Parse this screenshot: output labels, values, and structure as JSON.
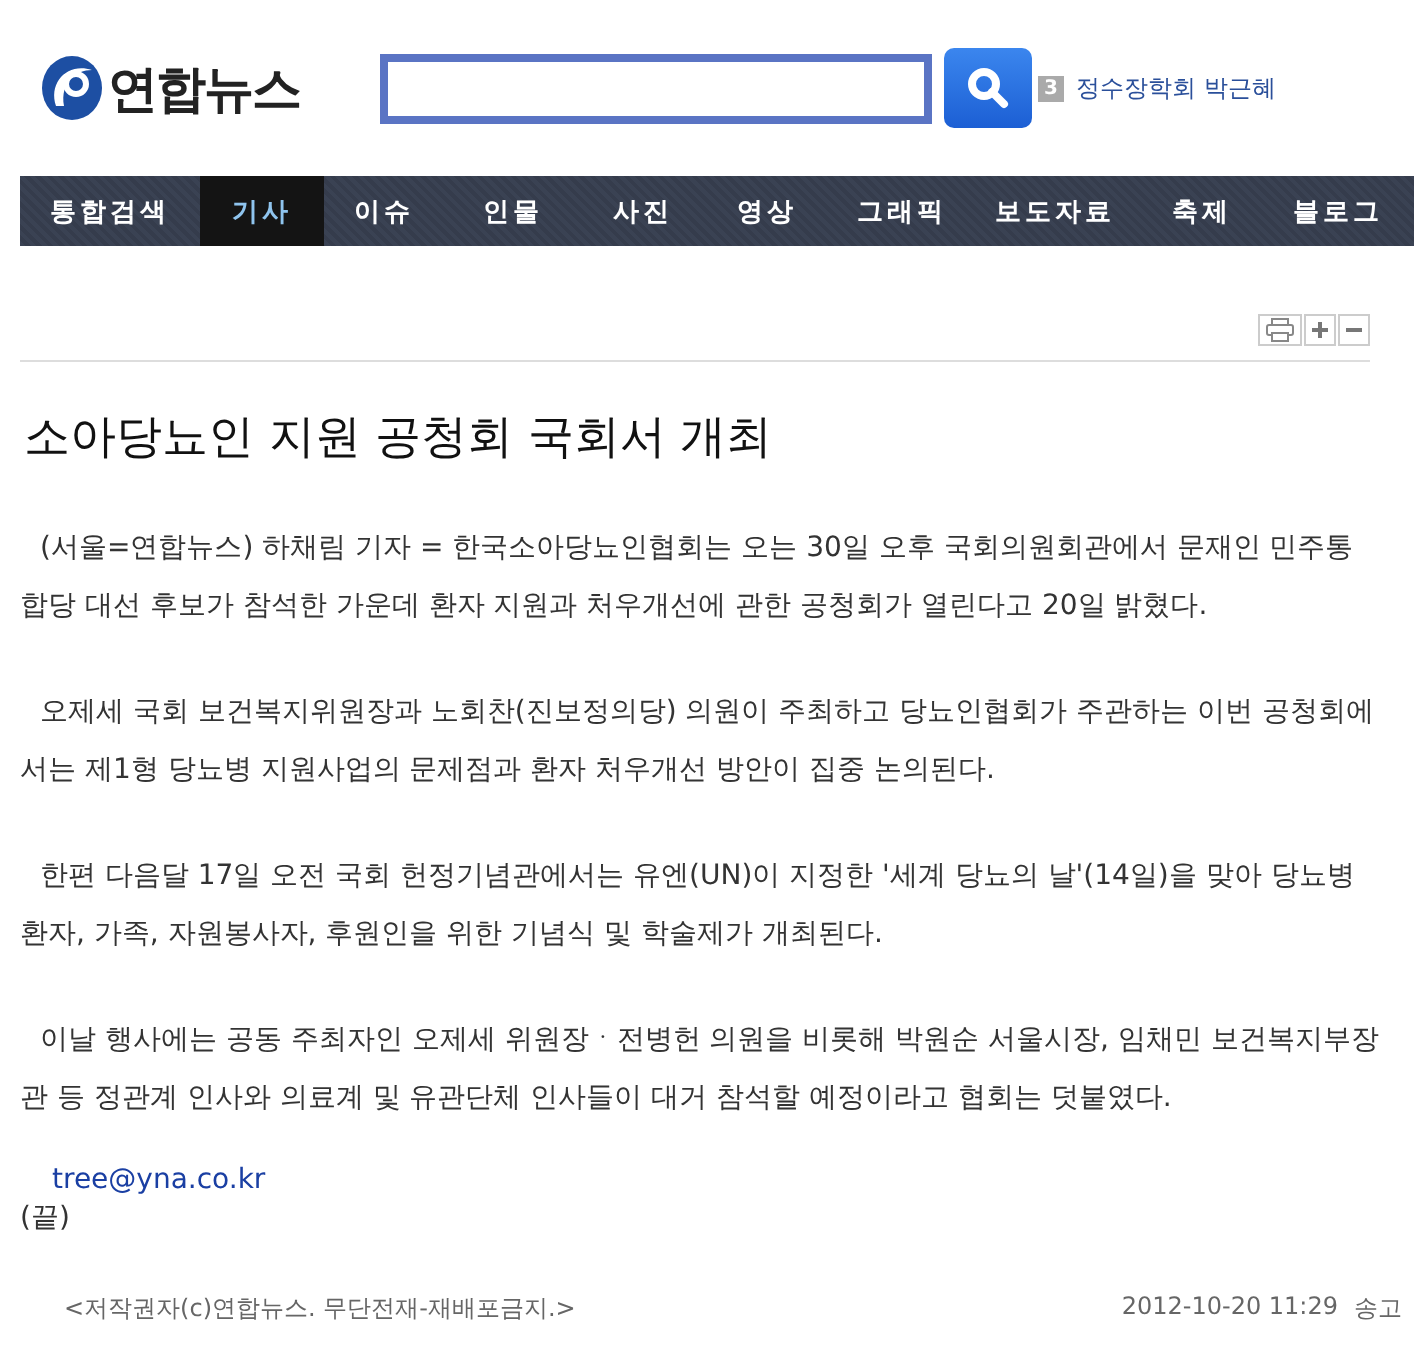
{
  "header": {
    "logo": "연합뉴스",
    "trending": {
      "rank": "3",
      "text": "정수장학회 박근혜"
    }
  },
  "nav": [
    {
      "label": "통합검색",
      "selected": false
    },
    {
      "label": "기사",
      "selected": true
    },
    {
      "label": "이슈",
      "selected": false
    },
    {
      "label": "인물",
      "selected": false
    },
    {
      "label": "사진",
      "selected": false
    },
    {
      "label": "영상",
      "selected": false
    },
    {
      "label": "그래픽",
      "selected": false
    },
    {
      "label": "보도자료",
      "selected": false
    },
    {
      "label": "축제",
      "selected": false
    },
    {
      "label": "블로그",
      "selected": false
    }
  ],
  "tools": [
    {
      "kind": "print"
    },
    {
      "kind": "plus"
    },
    {
      "kind": "minus"
    }
  ],
  "article": {
    "title": "소아당뇨인 지원 공청회 국회서 개최",
    "paragraphs": [
      "(서울=연합뉴스) 하채림 기자 = 한국소아당뇨인협회는 오는 30일 오후 국회의원회관에서 문재인 민주통합당 대선 후보가 참석한 가운데 환자 지원과 처우개선에 관한 공청회가 열린다고 20일 밝혔다.",
      "오제세 국회 보건복지위원장과 노회찬(진보정의당) 의원이 주최하고 당뇨인협회가 주관하는 이번 공청회에서는 제1형 당뇨병 지원사업의 문제점과 환자 처우개선 방안이 집중 논의된다.",
      "한편 다음달 17일 오전 국회 헌정기념관에서는 유엔(UN)이 지정한 '세계 당뇨의 날'(14일)을 맞아 당뇨병 환자, 가족, 자원봉사자, 후원인을 위한 기념식 및 학술제가 개최된다.",
      "이날 행사에는 공동 주최자인 오제세 위원장ㆍ전병헌 의원을 비롯해 박원순 서울시장, 임채민 보건복지부장관 등 정관계 인사와 의료계 및 유관단체 인사들이 대거 참석할 예정이라고 협회는 덧붙였다."
    ],
    "email": "tree@yna.co.kr",
    "end": "(끝)"
  },
  "footer": {
    "copyright": "<저작권자(c)연합뉴스. 무단전재-재배포금지.>",
    "timestamp": "2012-10-20 11:29",
    "send": "송고"
  }
}
